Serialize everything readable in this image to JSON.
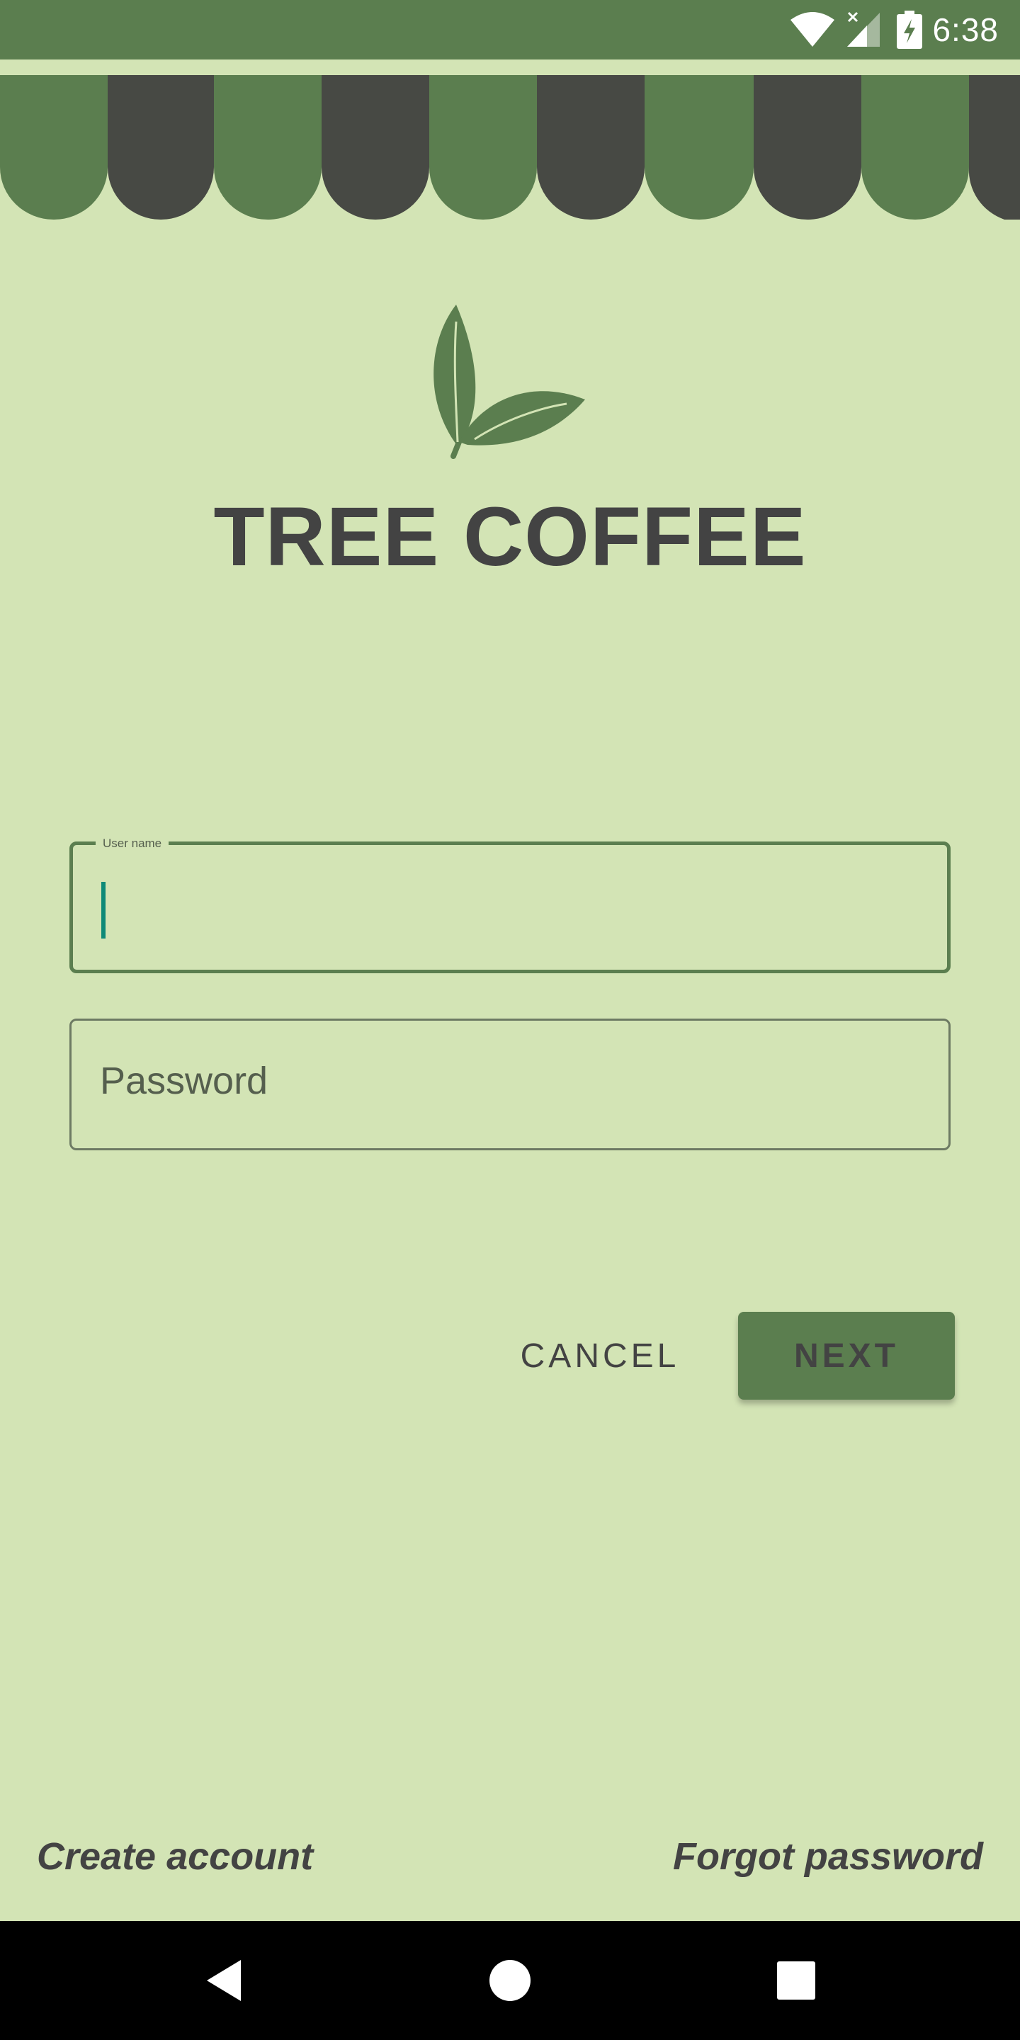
{
  "status_bar": {
    "time": "6:38",
    "icons": [
      "wifi-icon",
      "cell-signal-off-icon",
      "battery-charging-icon"
    ]
  },
  "app": {
    "title": "TREE COFFEE",
    "logo_icon": "leaves-icon"
  },
  "form": {
    "username": {
      "label": "User name",
      "value": ""
    },
    "password": {
      "placeholder": "Password",
      "value": ""
    }
  },
  "buttons": {
    "cancel_label": "CANCEL",
    "next_label": "NEXT"
  },
  "links": {
    "create_account": "Create account",
    "forgot_password": "Forgot password"
  },
  "nav": {
    "icons": [
      "back-icon",
      "home-icon",
      "recents-icon"
    ]
  },
  "colors": {
    "primary": "#5b7e4f",
    "background": "#d3e4b5",
    "awning_dark": "#474944",
    "text": "#434343",
    "caret": "#0e8a78"
  }
}
